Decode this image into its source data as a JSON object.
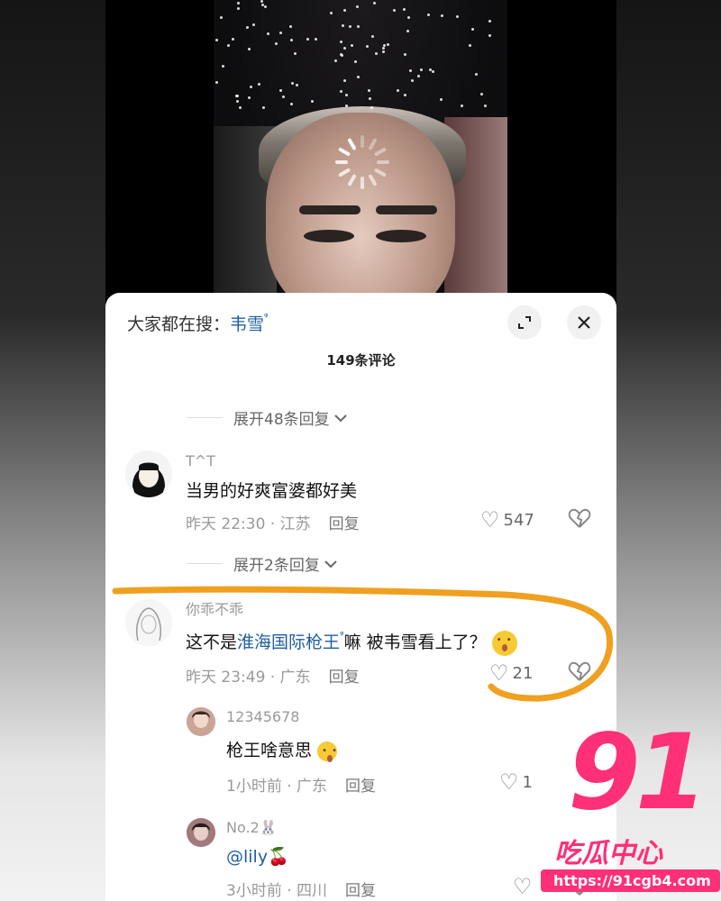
{
  "search": {
    "prefix": "大家都在搜：",
    "keyword": "韦雪",
    "search_glyph": "ᵠ"
  },
  "comments_header": {
    "count": "149条评论"
  },
  "expand_1": {
    "label": "展开48条回复"
  },
  "expand_2": {
    "label": "展开2条回复"
  },
  "comments": [
    {
      "username": "T^T",
      "text": "当男的好爽富婆都好美",
      "time_location": "昨天 22:30 · 江苏",
      "reply_label": "回复",
      "likes": "547"
    },
    {
      "username": "你乖不乖",
      "text_before": "这不是",
      "text_link": "淮海国际枪王",
      "text_after": "嘛 被韦雪看上了？",
      "time_location": "昨天 23:49 · 广东",
      "reply_label": "回复",
      "likes": "21"
    }
  ],
  "replies": [
    {
      "username": "12345678",
      "text": "枪王啥意思",
      "time_location": "1小时前 · 广东",
      "reply_label": "回复",
      "likes": "1"
    },
    {
      "username": "No.2🐰",
      "text": "@lily🍒",
      "time_location": "3小时前 · 四川",
      "reply_label": "回复",
      "likes": ""
    }
  ],
  "icons": {
    "expand": "expand-icon",
    "close": "close-icon",
    "heart": "heart-icon",
    "dislike": "dislike-icon",
    "chevron": "chevron-down-icon"
  },
  "watermark": {
    "number": "91",
    "subtitle": "吃瓜中心",
    "url": "https://91cgb4.com"
  },
  "colors": {
    "link": "#1f5f9f",
    "annotation": "#f0a020",
    "watermark": "#ff2f78"
  }
}
